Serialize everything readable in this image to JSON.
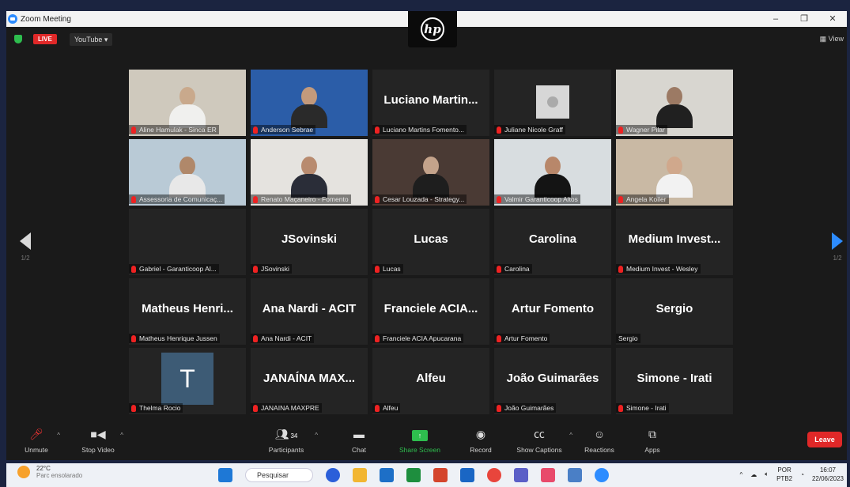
{
  "window": {
    "title": "Zoom Meeting",
    "controls": [
      "–",
      "❐",
      "✕"
    ]
  },
  "topbar": {
    "live": "LIVE",
    "stream": "YouTube ▾",
    "view": "View"
  },
  "pager": {
    "left_page": "1/2",
    "right_page": "1/2"
  },
  "tiles": [
    {
      "label": "Aline Hamulak - Sinca ER",
      "video": true,
      "bg": "#cfc9bd",
      "head": "#c9a98c",
      "body": "#f0f0ee"
    },
    {
      "label": "Anderson Sebrae",
      "video": true,
      "bg": "#2b5da8",
      "head": "#c39a7c",
      "body": "#2a2a2a"
    },
    {
      "big": "Luciano  Martin...",
      "label": "Luciano Martins Fomento..."
    },
    {
      "label": "Juliane Nicole Graff",
      "avatar": "placeholder"
    },
    {
      "label": "Wagner Pilar",
      "video": true,
      "bg": "#d8d6d0",
      "head": "#9c7a64",
      "body": "#202020"
    },
    {
      "label": "Assessoria de Comunicaç...",
      "video": true,
      "bg": "#b9cad6",
      "head": "#b0886a",
      "body": "#e8e8e8"
    },
    {
      "label": "Renato Maçaneiro - Fomento",
      "video": true,
      "active": true,
      "bg": "#e5e3df",
      "head": "#b88b6f",
      "body": "#2a2d38"
    },
    {
      "label": "Cesar Louzada - Strategy...",
      "video": true,
      "bg": "#4a3a34",
      "head": "#c4a38b",
      "body": "#1e1e1e"
    },
    {
      "label": "Valmir Garanticoop Altos",
      "video": true,
      "bg": "#d8dde0",
      "head": "#b8876a",
      "body": "#141414"
    },
    {
      "label": "Angela Koiler",
      "video": true,
      "bg": "#c9b9a4",
      "head": "#d0a88c",
      "body": "#f2f2f2"
    },
    {
      "big": "",
      "label": "Gabriel - Garanticoop Al..."
    },
    {
      "big": "JSovinski",
      "label": "JSovinski"
    },
    {
      "big": "Lucas",
      "label": "Lucas"
    },
    {
      "big": "Carolina",
      "label": "Carolina"
    },
    {
      "big": "Medium  Invest...",
      "label": "Medium Invest - Wesley"
    },
    {
      "big": "Matheus  Henri...",
      "label": "Matheus Henrique Jussen"
    },
    {
      "big": "Ana Nardi - ACIT",
      "label": "Ana Nardi - ACIT"
    },
    {
      "big": "Franciele  ACIA...",
      "label": "Franciele ACIA Apucarana"
    },
    {
      "big": "Artur Fomento",
      "label": "Artur Fomento"
    },
    {
      "big": "Sergio",
      "label": "Sergio",
      "nomic": true
    },
    {
      "label": "Thelma Rocio",
      "avatar": "T"
    },
    {
      "big": "JANAÍNA  MAX...",
      "label": "JANAINA MAXPRE"
    },
    {
      "big": "Alfeu",
      "label": "Alfeu"
    },
    {
      "big": "João Guimarães",
      "label": "João Guimarães"
    },
    {
      "big": "Simone - Irati",
      "label": "Simone - Irati"
    }
  ],
  "toolbar": {
    "unmute": "Unmute",
    "stop_video": "Stop Video",
    "participants": "Participants",
    "participants_count": "34",
    "chat": "Chat",
    "share_screen": "Share Screen",
    "record": "Record",
    "show_captions": "Show Captions",
    "reactions": "Reactions",
    "apps": "Apps",
    "leave": "Leave"
  },
  "taskbar": {
    "temp": "22°C",
    "weather": "Parc ensolarado",
    "search": "Pesquisar",
    "lang": "POR",
    "layout": "PTB2",
    "time": "16:07",
    "date": "22/06/2023"
  }
}
